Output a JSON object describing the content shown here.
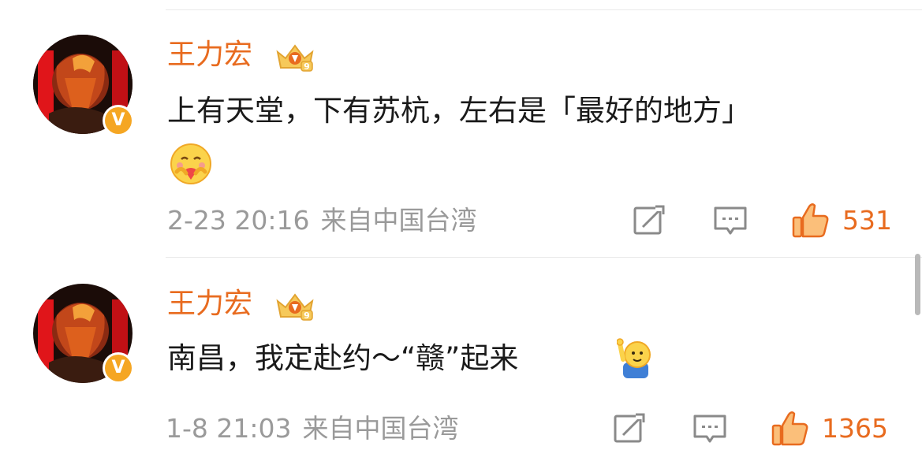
{
  "comments": [
    {
      "username": "王力宏",
      "verified_badge": "V",
      "content": "上有天堂，下有苏杭，左右是「最好的地方」",
      "emoji": "hugging-heart-face",
      "timestamp": "2-23 20:16",
      "source": "来自中国台湾",
      "like_count": "531"
    },
    {
      "username": "王力宏",
      "verified_badge": "V",
      "content": "南昌，我定赴约～“赣”起来",
      "emoji": "waving-character",
      "timestamp": "1-8 21:03",
      "source": "来自中国台湾",
      "like_count": "1365"
    }
  ],
  "icons": {
    "repost": "repost-icon",
    "comment": "comment-icon",
    "like": "thumbs-up-icon",
    "crown": "vip-crown-icon"
  },
  "colors": {
    "username": "#e86b1f",
    "like": "#e86b1f",
    "verified_badge": "#f5a623",
    "meta": "#9a9a9a",
    "text": "#1a1a1a"
  }
}
